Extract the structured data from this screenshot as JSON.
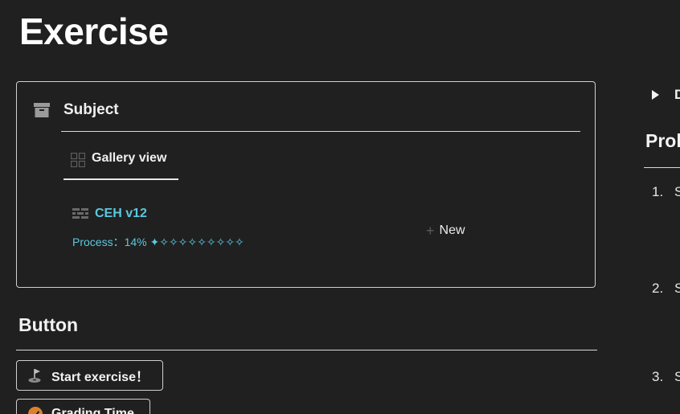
{
  "page": {
    "title": "Exercise"
  },
  "subject_card": {
    "header": "Subject",
    "tab": "Gallery view",
    "item": {
      "title": "CEH v12",
      "progress": "Process：14% ✦✧✧✧✧✧✧✧✧✧",
      "progress_value": 0.14
    },
    "new_label": "New"
  },
  "buttons_section": {
    "heading": "Button",
    "start": "Start exercise！",
    "grading": "Grading Time"
  },
  "right_column": {
    "toggle": "D",
    "heading": "Prol",
    "list": [
      {
        "num": "1.",
        "text": "S"
      },
      {
        "num": "2.",
        "text": "S"
      },
      {
        "num": "3.",
        "text": "S"
      }
    ]
  },
  "colors": {
    "background": "#202020",
    "link": "#5bc8e0",
    "border": "#d0d0d0"
  }
}
